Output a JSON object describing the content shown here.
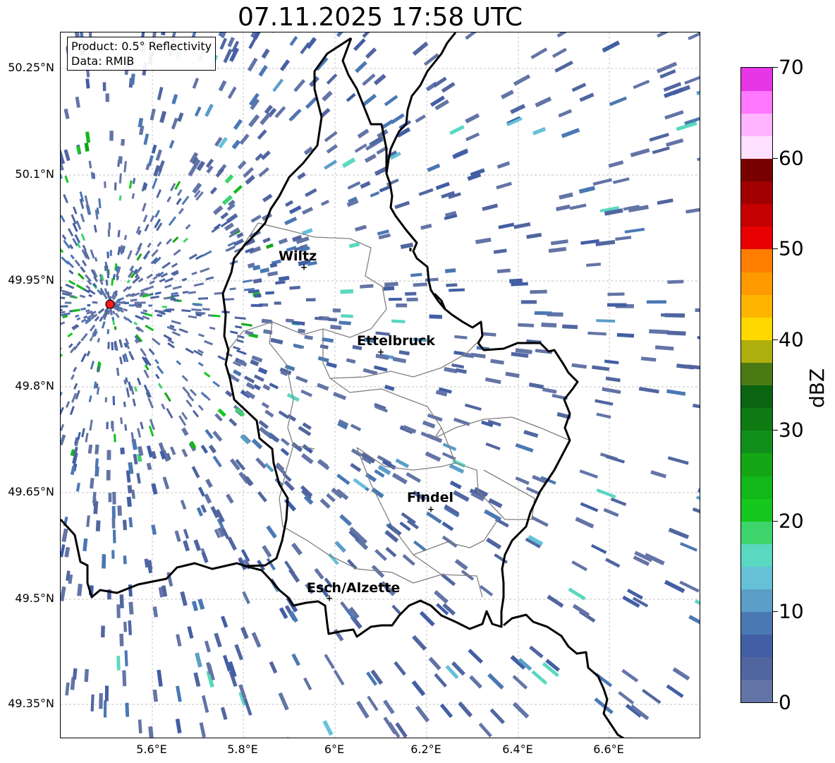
{
  "title": "07.11.2025 17:58 UTC",
  "info": {
    "product": "Product: 0.5° Reflectivity",
    "data_source": "Data: RMIB"
  },
  "axes": {
    "y_ticks": [
      "50.25°N",
      "50.1°N",
      "49.95°N",
      "49.8°N",
      "49.65°N",
      "49.5°N",
      "49.35°N"
    ],
    "x_ticks": [
      "5.6°E",
      "5.8°E",
      "6°E",
      "6.2°E",
      "6.4°E",
      "6.6°E"
    ]
  },
  "cities": [
    {
      "name": "Wiltz"
    },
    {
      "name": "Ettelbruck"
    },
    {
      "name": "Findel"
    },
    {
      "name": "Esch/Alzette"
    }
  ],
  "colorbar": {
    "label": "dBZ",
    "ticks": [
      "0",
      "10",
      "20",
      "30",
      "40",
      "50",
      "60",
      "70"
    ],
    "colors": [
      "#6374a6",
      "#5166a0",
      "#425ea4",
      "#4a78b3",
      "#5b9ec8",
      "#65c1d8",
      "#5ad8c0",
      "#3ed46c",
      "#14c81e",
      "#12b81a",
      "#14a614",
      "#10901a",
      "#0e7a12",
      "#0a6410",
      "#4a7a14",
      "#afb00e",
      "#ffd800",
      "#ffb400",
      "#ff9a00",
      "#ff7e00",
      "#e80000",
      "#c40000",
      "#a00000",
      "#780000",
      "#ffe0ff",
      "#ffb4ff",
      "#ff78ff",
      "#e636e6"
    ]
  },
  "radar_site": {
    "color": "#ff1a1a"
  }
}
